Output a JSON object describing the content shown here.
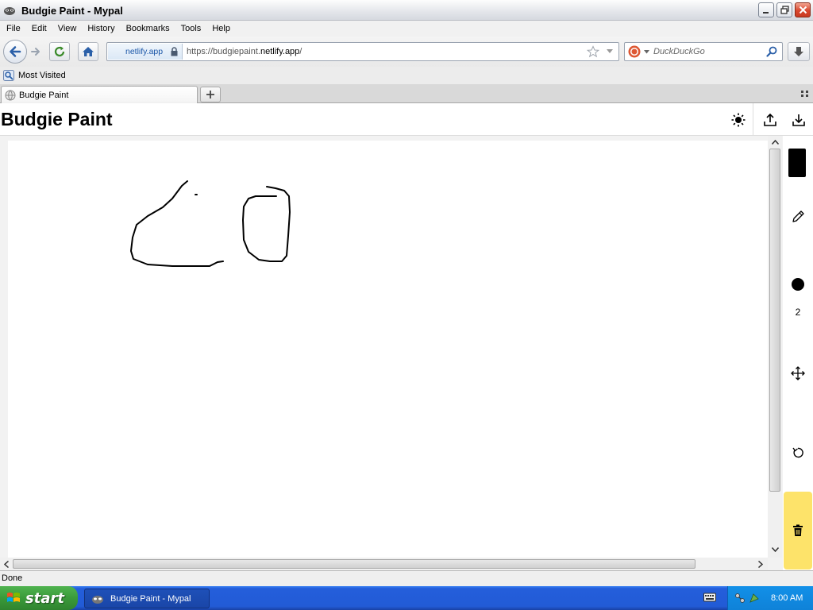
{
  "window": {
    "title": "Budgie Paint - Mypal",
    "minimize": "minimize",
    "restore": "restore",
    "close": "close"
  },
  "menu": [
    {
      "label": "File",
      "accel": "F"
    },
    {
      "label": "Edit",
      "accel": "E"
    },
    {
      "label": "View",
      "accel": "V"
    },
    {
      "label": "History",
      "accel": "H"
    },
    {
      "label": "Bookmarks",
      "accel": "B"
    },
    {
      "label": "Tools",
      "accel": "T"
    },
    {
      "label": "Help",
      "accel": "H"
    }
  ],
  "nav": {
    "site_identity": "netlify.app",
    "url_prefix": "https://budgiepaint.",
    "url_domain": "netlify.app",
    "url_suffix": "/",
    "search_placeholder": "DuckDuckGo"
  },
  "bookmarks": {
    "most_visited": "Most Visited"
  },
  "tabs": [
    {
      "label": "Budgie Paint"
    }
  ],
  "app": {
    "title": "Budgie Paint",
    "brush_size": "2",
    "current_color": "#000000",
    "delete_color": "#fde36a"
  },
  "status": {
    "text": "Done"
  },
  "taskbar": {
    "start_label": "start",
    "task_label": "Budgie Paint - Mypal",
    "clock": "8:00 AM"
  }
}
